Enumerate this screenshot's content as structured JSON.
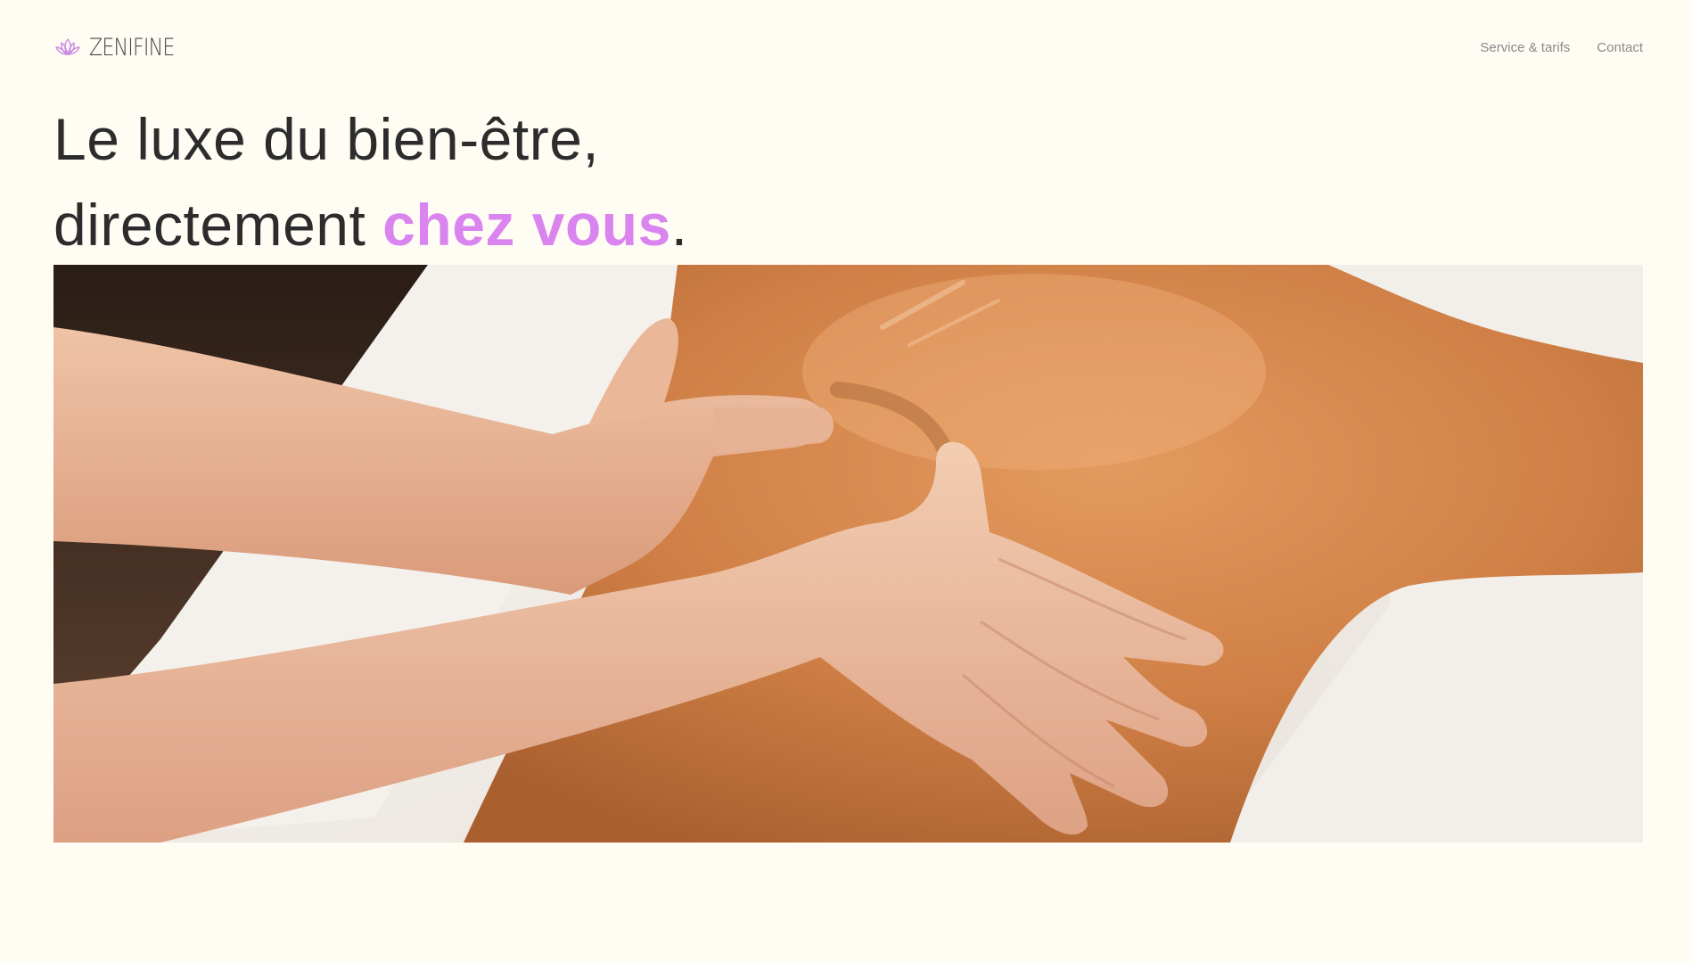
{
  "brand": {
    "name": "ZENIFINE",
    "icon": "lotus-icon",
    "accent_color": "#d984ef"
  },
  "nav": {
    "items": [
      {
        "label": "Service & tarifs"
      },
      {
        "label": "Contact"
      }
    ]
  },
  "hero": {
    "line1": "Le luxe du bien-être,",
    "line2_prefix": "directement ",
    "line2_accent": "chez vous",
    "line2_suffix": "."
  },
  "colors": {
    "background": "#fffcf4",
    "text": "#2c2c2c",
    "nav_text": "#8a8a8a"
  }
}
